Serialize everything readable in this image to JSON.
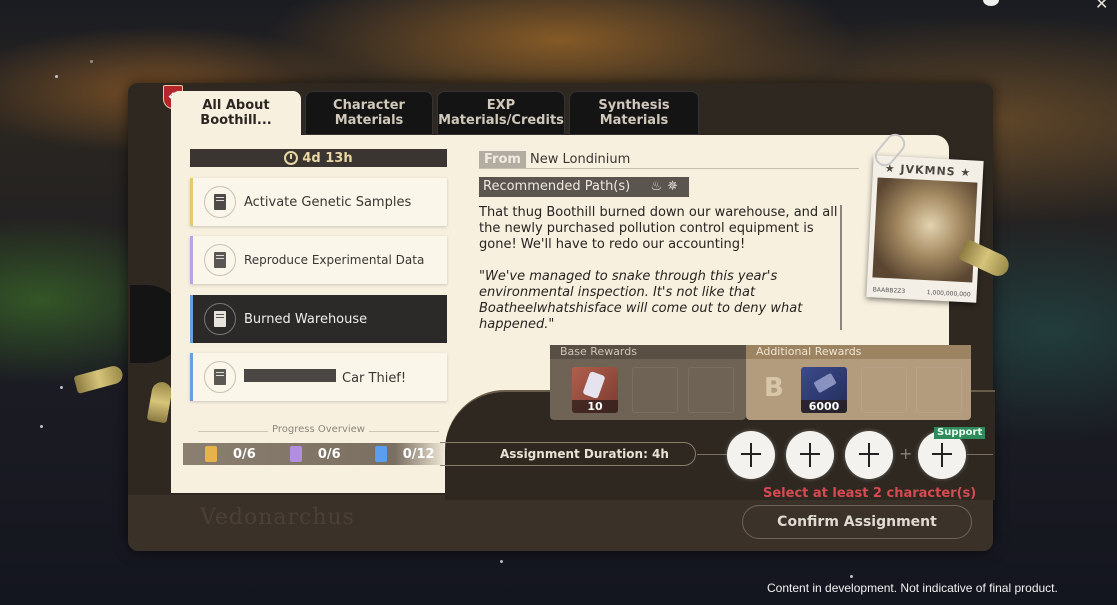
{
  "tabs": [
    {
      "label": "All About Boothill...",
      "line1": "All About",
      "line2": "Boothill...",
      "active": true
    },
    {
      "label": "Character Materials",
      "line1": "Character",
      "line2": "Materials",
      "active": false
    },
    {
      "label": "EXP Materials/Credits",
      "line1": "EXP",
      "line2": "Materials/Credits",
      "active": false
    },
    {
      "label": "Synthesis Materials",
      "line1": "Synthesis",
      "line2": "Materials",
      "active": false
    }
  ],
  "timer": "4d 13h",
  "missions": [
    {
      "label": "Activate Genetic Samples",
      "accent": "#e8c873",
      "icon": "genetic-sample-icon",
      "selected": false
    },
    {
      "label": "Reproduce Experimental Data",
      "accent": "#b9a3e6",
      "icon": "document-icon",
      "selected": false
    },
    {
      "label": "Burned Warehouse",
      "accent": "#6e9ce0",
      "icon": "document-icon",
      "selected": true
    },
    {
      "label": "Car Thief!",
      "accent": "#6e9ce0",
      "icon": "document-icon",
      "selected": false,
      "redacted_prefix": true
    }
  ],
  "progress": {
    "title": "Progress Overview",
    "items": [
      {
        "value": "0/6",
        "color": "#e8b24a",
        "icon": "genetic-sample-icon"
      },
      {
        "value": "0/6",
        "color": "#b18ee0",
        "icon": "experimental-data-icon"
      },
      {
        "value": "0/12",
        "color": "#5b9ef0",
        "icon": "document-icon"
      }
    ]
  },
  "detail": {
    "from_label": "From",
    "from_value": "New Londinium",
    "recommended_label": "Recommended Path(s)",
    "path_icons": [
      "abundance-path-icon",
      "destruction-path-icon"
    ],
    "description": "That thug Boothill burned down our warehouse, and all the newly purchased pollution control equipment is gone! We'll have to redo our accounting!",
    "quote": "\"We've managed to snake through this year's environmental inspection. It's not like that Boatheelwhatshisface will come out to deny what happened.\""
  },
  "wanted_poster": {
    "title": "★ JVKMNS ★",
    "footer_left": "BAABB2Z3",
    "footer_right": "1,000,000,000"
  },
  "rewards": {
    "base_label": "Base Rewards",
    "base_items": [
      {
        "name": "crystal-item",
        "qty": "10"
      }
    ],
    "additional_label": "Additional Rewards",
    "grade": "B",
    "additional_items": [
      {
        "name": "exp-material-item",
        "qty": "6000"
      }
    ]
  },
  "assignment": {
    "duration_label": "Assignment Duration: 4h",
    "slots": 3,
    "support_label": "Support",
    "warning": "Select at least 2 character(s)",
    "confirm_label": "Confirm Assignment"
  },
  "watermark": "Vedonarchus",
  "disclaimer": "Content in development. Not indicative of final product.",
  "colors": {
    "paper": "#f8f0df",
    "warning": "#d64a52",
    "support": "#2f8a5c",
    "emblem": "#b3262c"
  }
}
